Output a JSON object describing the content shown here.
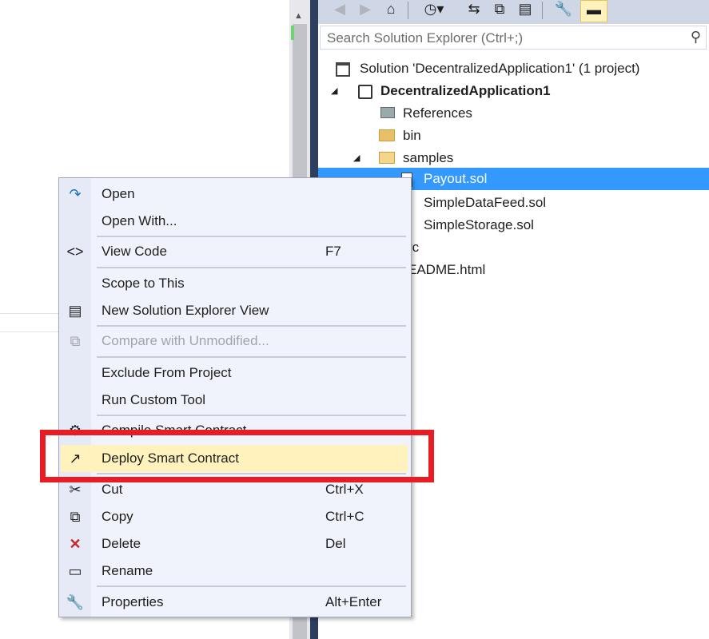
{
  "solution_explorer": {
    "search_placeholder": "Search Solution Explorer (Ctrl+;)",
    "toolbar_icons": [
      "back-icon",
      "forward-icon",
      "home-icon",
      "history-icon",
      "sync-icon",
      "collapse-all-icon",
      "show-all-files-icon",
      "properties-icon",
      "preview-icon"
    ],
    "tree": [
      {
        "label": "Solution 'DecentralizedApplication1' (1 project)",
        "icon": "solution-icon"
      },
      {
        "label": "DecentralizedApplication1",
        "icon": "project-icon",
        "bold": true
      },
      {
        "label": "References",
        "icon": "references-icon"
      },
      {
        "label": "bin",
        "icon": "folder-icon"
      },
      {
        "label": "samples",
        "icon": "folder-open-icon"
      },
      {
        "label": "Payout.sol",
        "icon": "file-icon",
        "selected": true
      },
      {
        "label": "SimpleDataFeed.sol",
        "icon": "file-icon"
      },
      {
        "label": "SimpleStorage.sol",
        "icon": "file-icon"
      },
      {
        "label": "rc",
        "icon": "folder-icon"
      },
      {
        "label": "EADME.html",
        "icon": "file-icon"
      }
    ]
  },
  "context_menu": {
    "items": [
      {
        "label": "Open",
        "icon": "open-arrow-icon"
      },
      {
        "label": "Open With..."
      },
      {
        "label": "View Code",
        "shortcut": "F7",
        "icon": "code-icon"
      },
      {
        "label": "Scope to This"
      },
      {
        "label": "New Solution Explorer View",
        "icon": "new-view-icon"
      },
      {
        "label": "Compare with Unmodified...",
        "icon": "compare-icon",
        "disabled": true
      },
      {
        "label": "Exclude From Project"
      },
      {
        "label": "Run Custom Tool"
      },
      {
        "label": "Compile Smart Contract",
        "icon": "gear-icon"
      },
      {
        "label": "Deploy Smart Contract",
        "icon": "deploy-arrow-icon",
        "highlighted": true
      },
      {
        "label": "Cut",
        "shortcut": "Ctrl+X",
        "icon": "scissors-icon"
      },
      {
        "label": "Copy",
        "shortcut": "Ctrl+C",
        "icon": "copy-icon"
      },
      {
        "label": "Delete",
        "shortcut": "Del",
        "icon": "delete-icon"
      },
      {
        "label": "Rename",
        "icon": "rename-icon"
      },
      {
        "label": "Properties",
        "shortcut": "Alt+Enter",
        "icon": "wrench-icon"
      }
    ]
  },
  "colors": {
    "selection": "#3399ff",
    "highlight": "#fff2bd",
    "annotation": "#e81c24"
  }
}
